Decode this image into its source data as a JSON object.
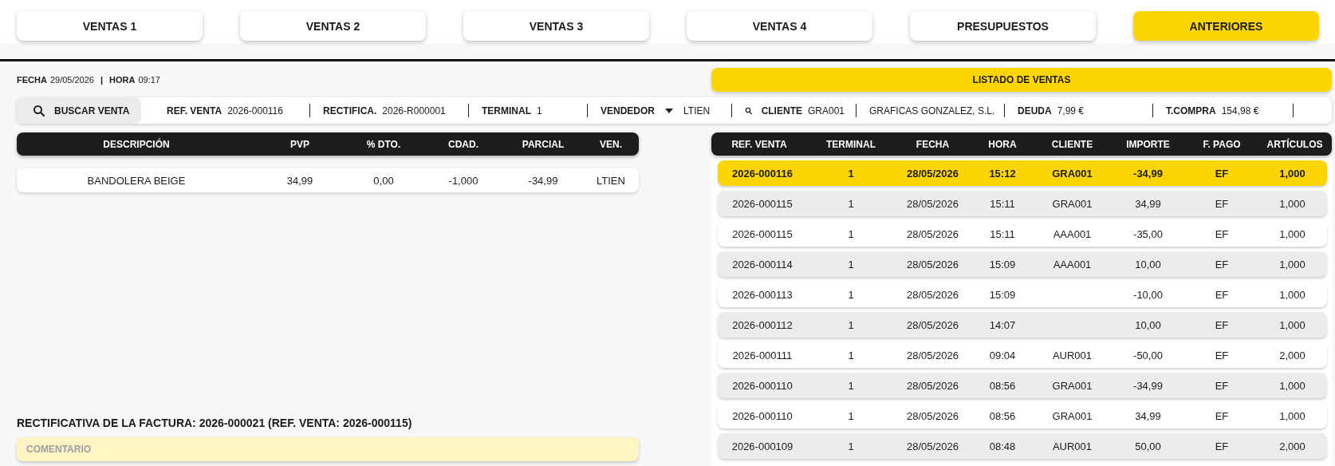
{
  "tabs": [
    {
      "label": "VENTAS 1",
      "selected": false
    },
    {
      "label": "VENTAS 2",
      "selected": false
    },
    {
      "label": "VENTAS 3",
      "selected": false
    },
    {
      "label": "VENTAS 4",
      "selected": false
    },
    {
      "label": "PRESUPUESTOS",
      "selected": false
    },
    {
      "label": "ANTERIORES",
      "selected": true
    }
  ],
  "datetime": {
    "fecha_label": "FECHA",
    "fecha": "29/05/2026",
    "separator": "|",
    "hora_label": "HORA",
    "hora": "09:17"
  },
  "listado_button": "LISTADO DE VENTAS",
  "info_bar": [
    {
      "kind": "search_button",
      "label": "BUSCAR VENTA"
    },
    {
      "kind": "field",
      "label": "REF. VENTA",
      "value": "2026-000116"
    },
    {
      "kind": "field",
      "label": "RECTIFICA.",
      "value": "2026-R000001"
    },
    {
      "kind": "field",
      "label": "TERMINAL",
      "value": "1"
    },
    {
      "kind": "dropdown",
      "label": "VENDEDOR",
      "value": "LTIEN"
    },
    {
      "kind": "search_field",
      "label": "CLIENTE",
      "value": "GRA001"
    },
    {
      "kind": "text",
      "value": "GRAFICAS GONZALEZ, S.L."
    },
    {
      "kind": "field",
      "label": "DEUDA",
      "value": "7,99 €"
    },
    {
      "kind": "field",
      "label": "T.COMPRA",
      "value": "154,98 €"
    }
  ],
  "lines_table": {
    "columns": [
      "DESCRIPCIÓN",
      "PVP",
      "% DTO.",
      "CDAD.",
      "PARCIAL",
      "VEN."
    ],
    "rows": [
      [
        "BANDOLERA BEIGE",
        "34,99",
        "0,00",
        "-1,000",
        "-34,99",
        "LTIEN"
      ]
    ]
  },
  "rectificativa": "RECTIFICATIVA DE LA FACTURA: 2026-000021 (REF. VENTA: 2026-000115)",
  "comment": {
    "placeholder": "COMENTARIO"
  },
  "sales_table": {
    "columns": [
      "REF. VENTA",
      "TERMINAL",
      "FECHA",
      "HORA",
      "CLIENTE",
      "IMPORTE",
      "F. PAGO",
      "ARTÍCULOS"
    ],
    "rows": [
      {
        "selected": true,
        "ref": "2026-000116",
        "terminal": "1",
        "fecha": "28/05/2026",
        "hora": "15:12",
        "cliente": "GRA001",
        "importe": "-34,99",
        "pago": "EF",
        "articulos": "1,000"
      },
      {
        "selected": false,
        "ref": "2026-000115",
        "terminal": "1",
        "fecha": "28/05/2026",
        "hora": "15:11",
        "cliente": "GRA001",
        "importe": "34,99",
        "pago": "EF",
        "articulos": "1,000"
      },
      {
        "selected": false,
        "ref": "2026-000115",
        "terminal": "1",
        "fecha": "28/05/2026",
        "hora": "15:11",
        "cliente": "AAA001",
        "importe": "-35,00",
        "pago": "EF",
        "articulos": "1,000"
      },
      {
        "selected": false,
        "ref": "2026-000114",
        "terminal": "1",
        "fecha": "28/05/2026",
        "hora": "15:09",
        "cliente": "AAA001",
        "importe": "10,00",
        "pago": "EF",
        "articulos": "1,000"
      },
      {
        "selected": false,
        "ref": "2026-000113",
        "terminal": "1",
        "fecha": "28/05/2026",
        "hora": "15:09",
        "importe": "-10,00",
        "pago": "EF",
        "articulos": "1,000"
      },
      {
        "selected": false,
        "ref": "2026-000112",
        "terminal": "1",
        "fecha": "28/05/2026",
        "hora": "14:07",
        "importe": "10,00",
        "pago": "EF",
        "articulos": "1,000"
      },
      {
        "selected": false,
        "ref": "2026-000111",
        "terminal": "1",
        "fecha": "28/05/2026",
        "hora": "09:04",
        "cliente": "AUR001",
        "importe": "-50,00",
        "pago": "EF",
        "articulos": "2,000"
      },
      {
        "selected": false,
        "ref": "2026-000110",
        "terminal": "1",
        "fecha": "28/05/2026",
        "hora": "08:56",
        "cliente": "GRA001",
        "importe": "-34,99",
        "pago": "EF",
        "articulos": "1,000"
      },
      {
        "selected": false,
        "ref": "2026-000110",
        "terminal": "1",
        "fecha": "28/05/2026",
        "hora": "08:56",
        "cliente": "GRA001",
        "importe": "34,99",
        "pago": "EF",
        "articulos": "1,000"
      },
      {
        "selected": false,
        "ref": "2026-000109",
        "terminal": "1",
        "fecha": "28/05/2026",
        "hora": "08:48",
        "cliente": "AUR001",
        "importe": "50,00",
        "pago": "EF",
        "articulos": "2,000"
      }
    ]
  }
}
